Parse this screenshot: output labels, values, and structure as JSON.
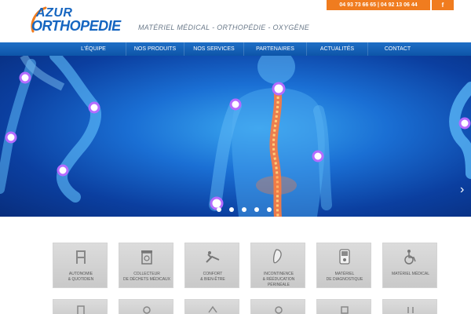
{
  "header": {
    "logo_line1": "AZUR",
    "logo_line2": "ORTHOPEDIE",
    "tagline": "MATÉRIEL MÉDICAL - ORTHOPÉDIE - OXYGÈNE",
    "phones": "04 93 73 66 65 | 04 92 13 06 44",
    "facebook_label": "f"
  },
  "nav": {
    "items": [
      {
        "label": "L'ÉQUIPE"
      },
      {
        "label": "NOS PRODUITS"
      },
      {
        "label": "NOS SERVICES"
      },
      {
        "label": "PARTENAIRES"
      },
      {
        "label": "ACTUALITÉS"
      },
      {
        "label": "CONTACT"
      }
    ]
  },
  "slider": {
    "dots": 5,
    "active_dot": 0,
    "next_label": "›"
  },
  "categories": [
    {
      "label_line1": "AUTONOMIE",
      "label_line2": "& QUOTIDIEN",
      "icon": "walker-icon"
    },
    {
      "label_line1": "COLLECTEUR",
      "label_line2": "DE DÉCHETS MÉDICAUX",
      "icon": "biohazard-bin-icon"
    },
    {
      "label_line1": "CONFORT",
      "label_line2": "& BIEN-ÊTRE",
      "icon": "recliner-icon"
    },
    {
      "label_line1": "INCONTINENCE",
      "label_line2": "& RÉÉDUCATION PÉRINÉALE",
      "icon": "pad-icon"
    },
    {
      "label_line1": "MATÉRIEL",
      "label_line2": "DE DIAGNOSTIQUE",
      "icon": "monitor-icon"
    },
    {
      "label_line1": "MATÉRIEL MÉDICAL",
      "label_line2": "",
      "icon": "wheelchair-icon"
    }
  ],
  "colors": {
    "accent_orange": "#f07c1f",
    "nav_blue": "#1565c0",
    "tile_grey": "#d3d3d3"
  }
}
